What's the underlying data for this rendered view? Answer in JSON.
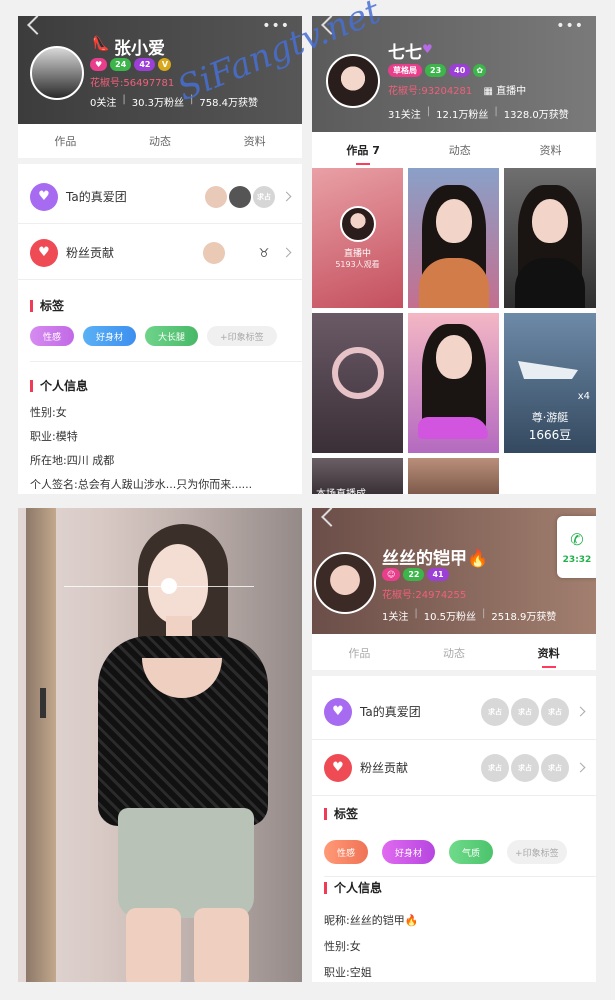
{
  "p1": {
    "name": "张小爱",
    "badges": [
      "24",
      "42",
      "V"
    ],
    "id_label": "花椒号:",
    "id_value": "56497781",
    "follow": "0关注",
    "fans": "30.3万粉丝",
    "likes": "758.4万获赞",
    "tabs": [
      "作品",
      "动态",
      "资料"
    ],
    "fan_club_label": "Ta的真爱团",
    "contrib_label": "粉丝贡献",
    "tags_title": "标签",
    "tags": [
      "性感",
      "好身材",
      "大长腿",
      "+印象标签"
    ],
    "info_title": "个人信息",
    "info": [
      "性别:女",
      "职业:模特",
      "所在地:四川 成都",
      "个人签名:总会有人跋山涉水...只为你而来......"
    ]
  },
  "p2": {
    "name": "七七",
    "badges": [
      "草格局",
      "23",
      "40"
    ],
    "id_label": "花椒号:",
    "id_value": "93204281",
    "live_text": "直播中",
    "follow": "31关注",
    "fans": "12.1万粉丝",
    "likes": "1328.0万获赞",
    "tabs": [
      "作品 7",
      "动态",
      "资料"
    ],
    "live_cell_title": "直播中",
    "live_cell_viewers": "5193人观看",
    "gift_name": "尊·游艇",
    "gift_price": "1666豆",
    "gift_mult": "x4",
    "caption": "本场直播成"
  },
  "p4": {
    "name": "丝丝的铠甲🔥",
    "badges": [
      "22",
      "41"
    ],
    "id_label": "花椒号:",
    "id_value": "24974255",
    "follow": "1关注",
    "fans": "10.5万粉丝",
    "likes": "2518.9万获赞",
    "tabs": [
      "作品",
      "动态",
      "资料"
    ],
    "fan_club_label": "Ta的真爱团",
    "contrib_label": "粉丝贡献",
    "placeholder_av": "求占",
    "tags_title": "标签",
    "tags": [
      "性感",
      "好身材",
      "气质",
      "+印象标签"
    ],
    "info_title": "个人信息",
    "info": [
      "昵称:丝丝的铠甲🔥",
      "性别:女",
      "职业:空姐"
    ],
    "call_time": "23:32"
  },
  "watermark": "SiFangtv.net",
  "icons": {
    "back": "back-arrow-icon",
    "more": "more-icon",
    "heart": "heart-icon",
    "phone": "phone-icon"
  },
  "colors": {
    "accent": "#ff3b5c",
    "id_pink": "#f0607a",
    "call_green": "#21b14a"
  }
}
